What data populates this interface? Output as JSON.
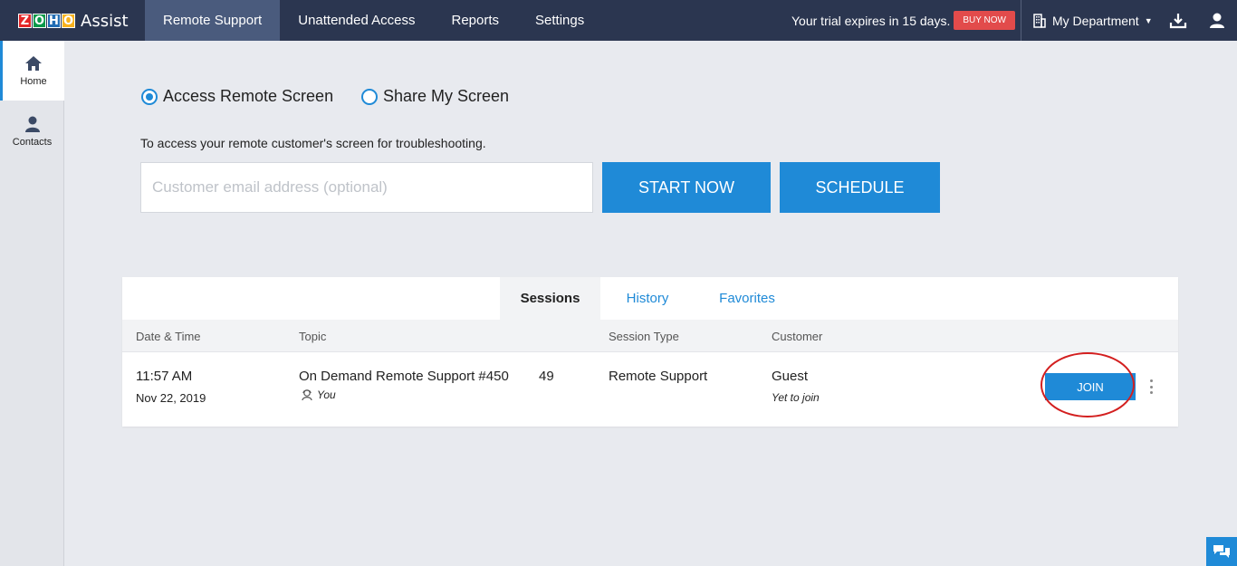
{
  "header": {
    "logo_letters": [
      "Z",
      "O",
      "H",
      "O"
    ],
    "logo_colors": [
      "#e42527",
      "#089949",
      "#226db4",
      "#f9b21d"
    ],
    "app_name": "Assist",
    "nav": [
      {
        "label": "Remote Support",
        "active": true
      },
      {
        "label": "Unattended Access",
        "active": false
      },
      {
        "label": "Reports",
        "active": false
      },
      {
        "label": "Settings",
        "active": false
      }
    ],
    "trial_text": "Your trial expires in 15 days.",
    "buy_now": "BUY NOW",
    "department": "My Department",
    "download_icon": "download-icon",
    "user_icon": "user-icon"
  },
  "sidebar": {
    "items": [
      {
        "label": "Home",
        "icon": "home-icon",
        "active": true
      },
      {
        "label": "Contacts",
        "icon": "contacts-icon",
        "active": false
      }
    ]
  },
  "main": {
    "mode_options": [
      {
        "label": "Access Remote Screen",
        "selected": true
      },
      {
        "label": "Share My Screen",
        "selected": false
      }
    ],
    "description": "To access your remote customer's screen for troubleshooting.",
    "email_placeholder": "Customer email address (optional)",
    "email_value": "",
    "start_now": "START NOW",
    "schedule": "SCHEDULE"
  },
  "sessions": {
    "tabs": [
      {
        "label": "Sessions",
        "active": true
      },
      {
        "label": "History",
        "active": false
      },
      {
        "label": "Favorites",
        "active": false
      }
    ],
    "columns": [
      "Date & Time",
      "Topic",
      "Session Type",
      "Customer"
    ],
    "rows": [
      {
        "time": "11:57 AM",
        "date": "Nov 22, 2019",
        "topic": "On Demand Remote Support #450",
        "topic_suffix": "49",
        "owner": "You",
        "session_type": "Remote Support",
        "customer": "Guest",
        "customer_status": "Yet to join",
        "action": "JOIN"
      }
    ]
  },
  "colors": {
    "topbar": "#2b3650",
    "accent": "#1f8ad7",
    "buy_now": "#e24b4b",
    "highlight_ring": "#d31f1f"
  }
}
